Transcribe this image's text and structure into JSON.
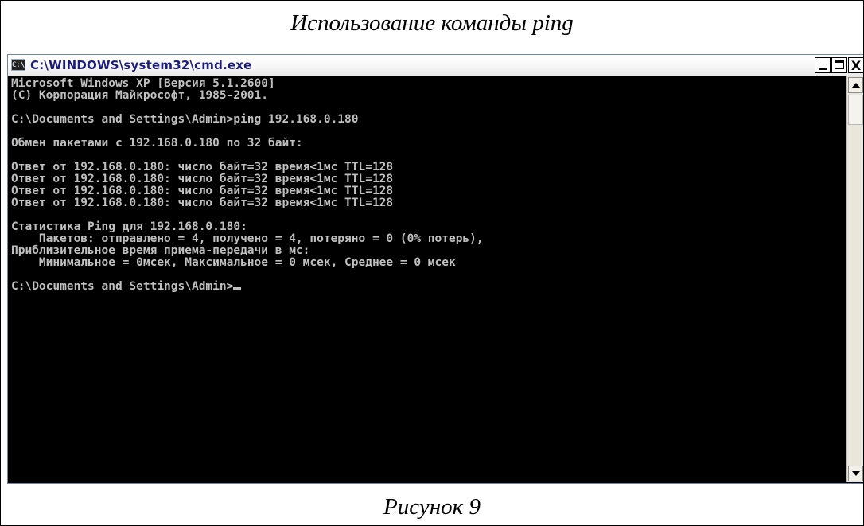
{
  "figure": {
    "caption_top": "Использование команды ping",
    "caption_bottom": "Рисунок 9"
  },
  "window": {
    "icon_label": "C:\\",
    "title": "C:\\WINDOWS\\system32\\cmd.exe",
    "controls": {
      "minimize": "_",
      "maximize": "□",
      "close": "X"
    }
  },
  "console": {
    "lines": [
      "Microsoft Windows XP [Версия 5.1.2600]",
      "(С) Корпорация Майкрософт, 1985-2001.",
      "",
      "C:\\Documents and Settings\\Admin>ping 192.168.0.180",
      "",
      "Обмен пакетами с 192.168.0.180 по 32 байт:",
      "",
      "Ответ от 192.168.0.180: число байт=32 время<1мс TTL=128",
      "Ответ от 192.168.0.180: число байт=32 время<1мс TTL=128",
      "Ответ от 192.168.0.180: число байт=32 время<1мс TTL=128",
      "Ответ от 192.168.0.180: число байт=32 время<1мс TTL=128",
      "",
      "Статистика Ping для 192.168.0.180:",
      "    Пакетов: отправлено = 4, получено = 4, потеряно = 0 (0% потерь),",
      "Приблизительное время приема-передачи в мс:",
      "    Минимальное = 0мсек, Максимальное = 0 мсек, Среднее = 0 мсек",
      ""
    ],
    "prompt": "C:\\Documents and Settings\\Admin>"
  },
  "colors": {
    "console_bg": "#000000",
    "console_fg": "#c0c0c0",
    "title_text": "#1c1c7c"
  }
}
